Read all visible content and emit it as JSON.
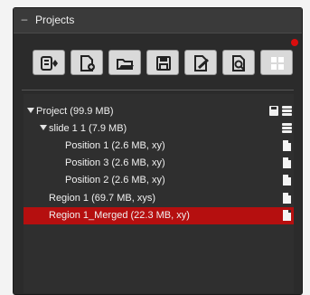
{
  "panel": {
    "title": "Projects",
    "toolbar_buttons": [
      {
        "name": "export-icon"
      },
      {
        "name": "add-doc-icon"
      },
      {
        "name": "open-folder-icon"
      },
      {
        "name": "save-icon"
      },
      {
        "name": "edit-doc-icon"
      },
      {
        "name": "search-doc-icon"
      },
      {
        "name": "grid-icon"
      }
    ],
    "tree": {
      "rows": [
        {
          "label": "Project   (99.9 MB)",
          "level": 0,
          "expanded": true,
          "icons": [
            "save-icon",
            "stack-icon"
          ],
          "selected": false
        },
        {
          "label": "slide 1 1   (7.9 MB)",
          "level": 1,
          "expanded": true,
          "icons": [
            "stack-icon"
          ],
          "selected": false
        },
        {
          "label": "Position 1   (2.6 MB, xy)",
          "level": 2,
          "icons": [
            "doc-icon"
          ],
          "selected": false
        },
        {
          "label": "Position 3   (2.6 MB, xy)",
          "level": 2,
          "icons": [
            "doc-icon"
          ],
          "selected": false
        },
        {
          "label": "Position 2   (2.6 MB, xy)",
          "level": 2,
          "icons": [
            "doc-icon"
          ],
          "selected": false
        },
        {
          "label": "Region 1   (69.7 MB, xys)",
          "level": 1,
          "icons": [
            "doc-icon"
          ],
          "selected": false
        },
        {
          "label": "Region 1_Merged   (22.3 MB, xy)",
          "level": 1,
          "icons": [
            "doc-icon"
          ],
          "selected": true
        }
      ]
    }
  },
  "colors": {
    "selected": "#b50f0f",
    "panel_bg": "#2b2b2b",
    "button_bg": "#d9d9d9",
    "notify": "#d90d0d"
  }
}
